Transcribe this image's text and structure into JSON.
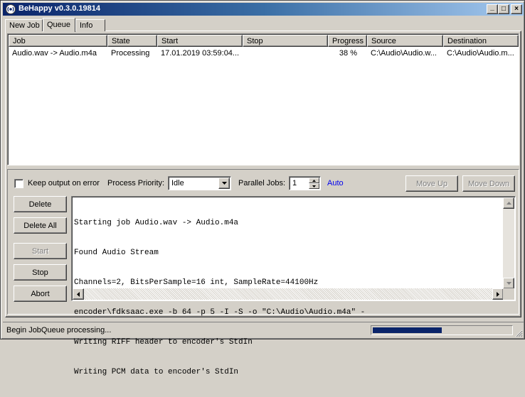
{
  "window": {
    "title": "BeHappy v0.3.0.19814",
    "minimize_label": "_",
    "maximize_label": "□",
    "close_label": "×"
  },
  "tabs": [
    {
      "label": "New Job"
    },
    {
      "label": "Queue"
    },
    {
      "label": "Info"
    }
  ],
  "queue": {
    "columns": [
      "Job",
      "State",
      "Start",
      "Stop",
      "Progress",
      "Source",
      "Destination"
    ],
    "rows": [
      {
        "job": "Audio.wav -> Audio.m4a",
        "state": "Processing",
        "start": "17.01.2019 03:59:04...",
        "stop": "",
        "progress": "38 %",
        "source": "C:\\Audio\\Audio.w...",
        "destination": "C:\\Audio\\Audio.m..."
      }
    ]
  },
  "options": {
    "keep_output_label": "Keep output on error",
    "keep_output_checked": false,
    "priority_label": "Process Priority:",
    "priority_value": "Idle",
    "parallel_label": "Parallel Jobs:",
    "parallel_value": "1",
    "auto_label": "Auto"
  },
  "buttons": {
    "move_up": "Move Up",
    "move_down": "Move Down",
    "delete": "Delete",
    "delete_all": "Delete All",
    "start": "Start",
    "stop": "Stop",
    "abort": "Abort"
  },
  "log": {
    "lines": [
      "Starting job Audio.wav -> Audio.m4a",
      "Found Audio Stream",
      "Channels=2, BitsPerSample=16 int, SampleRate=44100Hz",
      "encoder\\fdksaac.exe -b 64 -p 5 -I -S -o \"C:\\Audio\\Audio.m4a\" -",
      "Writing RIFF header to encoder's StdIn",
      "Writing PCM data to encoder's StdIn"
    ]
  },
  "status": {
    "text": "Begin JobQueue processing...",
    "progress": 0.5
  },
  "colors": {
    "title_bar": "#0a246a",
    "progress_fill": "#0a246a",
    "link": "#0000ee",
    "face": "#d4d0c8"
  }
}
